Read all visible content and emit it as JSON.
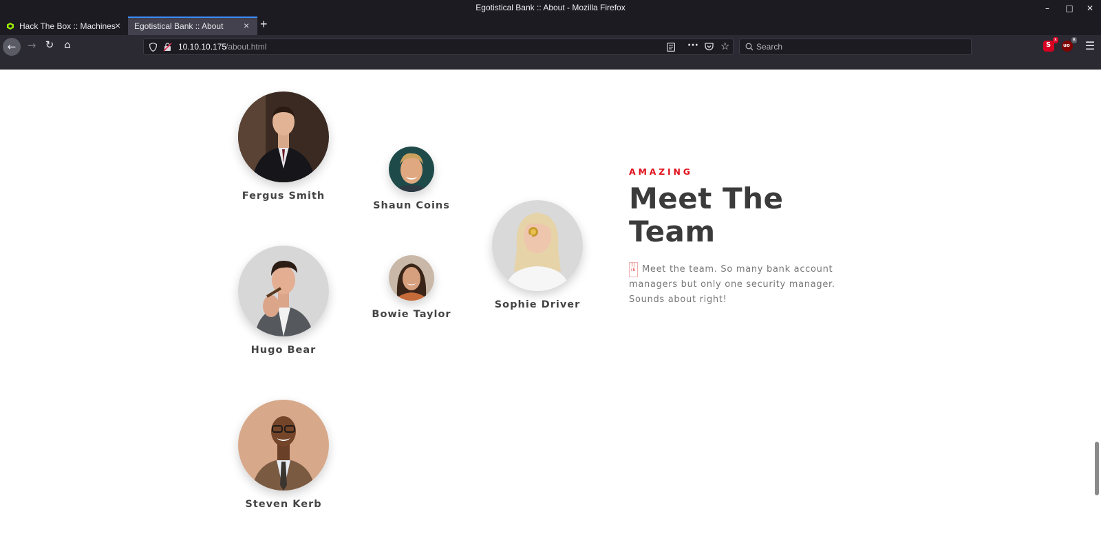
{
  "window": {
    "title": "Egotistical Bank :: About - Mozilla Firefox"
  },
  "tabs": [
    {
      "label": "Hack The Box :: Machines"
    },
    {
      "label": "Egotistical Bank :: About"
    }
  ],
  "navbar": {
    "url_host": "10.10.10.175",
    "url_path": "/about.html",
    "search_placeholder": "Search",
    "extension_badges": [
      "3",
      "8"
    ]
  },
  "team": {
    "eyebrow": "AMAZING",
    "heading": "Meet The Team",
    "broken_image_text": "t| ib",
    "description": "Meet the team. So many bank account managers but only one security manager. Sounds about right!",
    "members": [
      {
        "name": "Fergus Smith"
      },
      {
        "name": "Shaun Coins"
      },
      {
        "name": "Sophie Driver"
      },
      {
        "name": "Hugo Bear"
      },
      {
        "name": "Bowie Taylor"
      },
      {
        "name": "Steven Kerb"
      }
    ]
  },
  "colors": {
    "accent": "#e0101b",
    "heading": "#3b3b3b",
    "browser_chrome": "#1c1b22",
    "active_tab_line": "#3c8dff"
  }
}
